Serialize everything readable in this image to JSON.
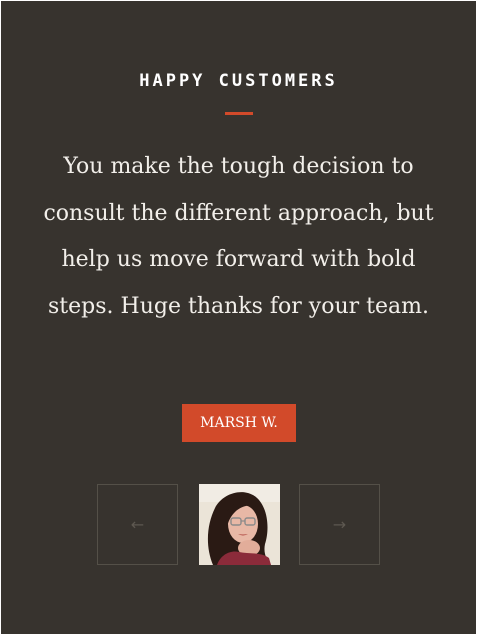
{
  "section": {
    "heading": "HAPPY CUSTOMERS",
    "accent_color": "#d24a2a",
    "background_color": "#37332e"
  },
  "testimonial": {
    "quote": "You make the tough decision to consult the different approach, but help us move forward with bold steps. Huge thanks for your team.",
    "author": "MARSH W."
  },
  "navigation": {
    "prev_label": "←",
    "next_label": "→",
    "prev_icon": "arrow-left-icon",
    "next_icon": "arrow-right-icon"
  },
  "avatar": {
    "icon": "customer-avatar"
  }
}
